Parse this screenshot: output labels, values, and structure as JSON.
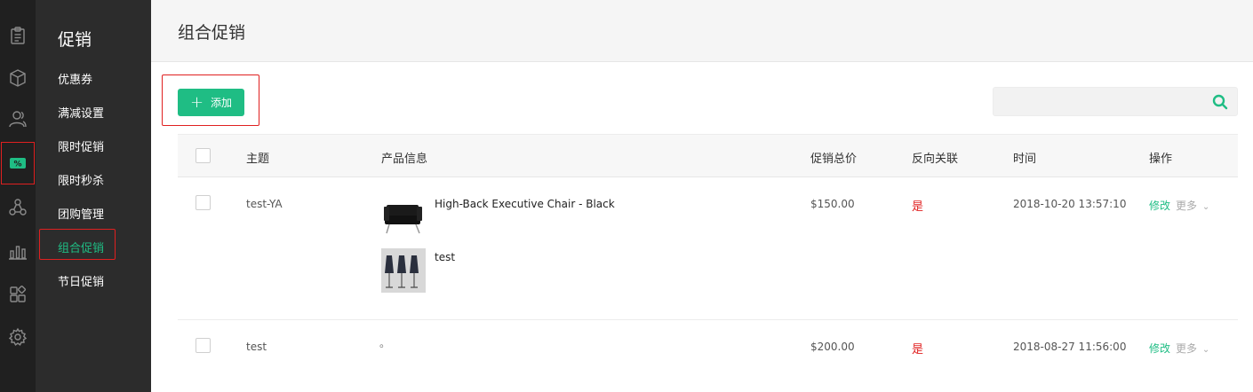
{
  "rail": {
    "items": [
      {
        "icon": "clipboard-icon"
      },
      {
        "icon": "box-icon"
      },
      {
        "icon": "users-icon"
      },
      {
        "icon": "promotion-icon",
        "active": true
      },
      {
        "icon": "network-icon"
      },
      {
        "icon": "bar-chart-icon"
      },
      {
        "icon": "apps-icon"
      },
      {
        "icon": "gear-icon"
      }
    ]
  },
  "sidebar": {
    "title": "促销",
    "items": [
      {
        "label": "优惠券"
      },
      {
        "label": "满减设置"
      },
      {
        "label": "限时促销"
      },
      {
        "label": "限时秒杀"
      },
      {
        "label": "团购管理"
      },
      {
        "label": "组合促销",
        "active": true
      },
      {
        "label": "节日促销"
      }
    ]
  },
  "header": {
    "title": "组合促销"
  },
  "toolbar": {
    "add_label": "添加",
    "search_placeholder": ""
  },
  "table": {
    "columns": [
      "主题",
      "产品信息",
      "促销总价",
      "反向关联",
      "时间",
      "操作"
    ],
    "rows": [
      {
        "subject": "test-YA",
        "products": [
          "High-Back Executive Chair - Black",
          "test"
        ],
        "total": "$150.00",
        "reverse": "是",
        "time": "2018-10-20 13:57:10",
        "edit": "修改",
        "more": "更多"
      },
      {
        "subject": "test",
        "products": [
          "。"
        ],
        "total": "$200.00",
        "reverse": "是",
        "time": "2018-08-27 11:56:00",
        "edit": "修改",
        "more": "更多"
      }
    ]
  },
  "colors": {
    "accent": "#1fbd84",
    "danger": "#e02020",
    "rail_bg": "#202020",
    "sidebar_bg": "#2c2c2c"
  }
}
